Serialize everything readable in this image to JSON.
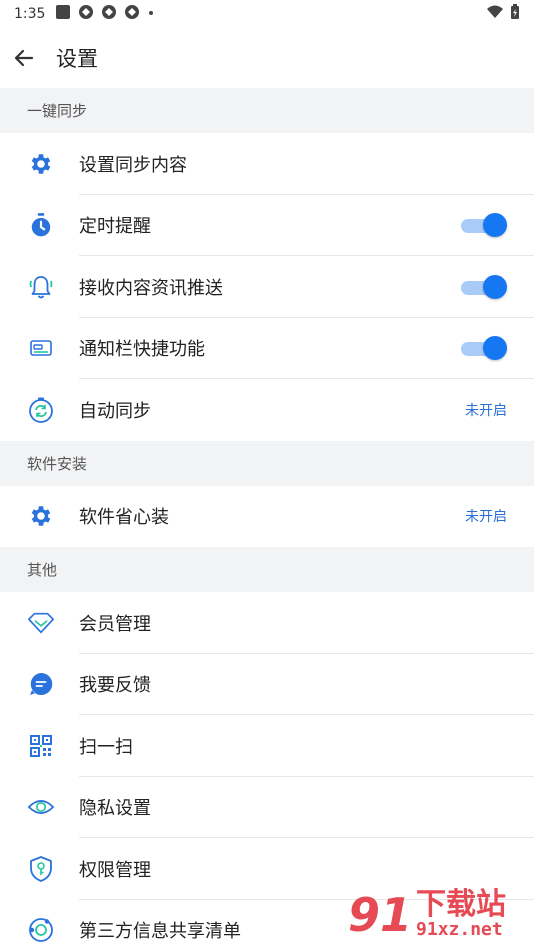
{
  "statusbar": {
    "time": "1:35"
  },
  "header": {
    "title": "设置"
  },
  "sections": [
    {
      "header": "一键同步",
      "items": [
        {
          "label": "设置同步内容",
          "icon": "gear-icon"
        },
        {
          "label": "定时提醒",
          "icon": "stopwatch-icon",
          "toggle": true
        },
        {
          "label": "接收内容资讯推送",
          "icon": "bell-icon",
          "toggle": true
        },
        {
          "label": "通知栏快捷功能",
          "icon": "card-icon",
          "toggle": true
        },
        {
          "label": "自动同步",
          "icon": "sync-clock-icon",
          "value": "未开启"
        }
      ]
    },
    {
      "header": "软件安装",
      "items": [
        {
          "label": "软件省心装",
          "icon": "gear-icon",
          "value": "未开启"
        }
      ]
    },
    {
      "header": "其他",
      "items": [
        {
          "label": "会员管理",
          "icon": "diamond-icon"
        },
        {
          "label": "我要反馈",
          "icon": "chat-icon"
        },
        {
          "label": "扫一扫",
          "icon": "qr-icon"
        },
        {
          "label": "隐私设置",
          "icon": "eye-icon"
        },
        {
          "label": "权限管理",
          "icon": "shield-key-icon"
        },
        {
          "label": "第三方信息共享清单",
          "icon": "share-circle-icon"
        }
      ]
    }
  ],
  "watermark": {
    "logo": "91",
    "title": "下载站",
    "site": "91xz.net"
  },
  "colors": {
    "accent": "#1677f2",
    "link": "#2a6fd6",
    "section_bg": "#f2f3f5"
  }
}
